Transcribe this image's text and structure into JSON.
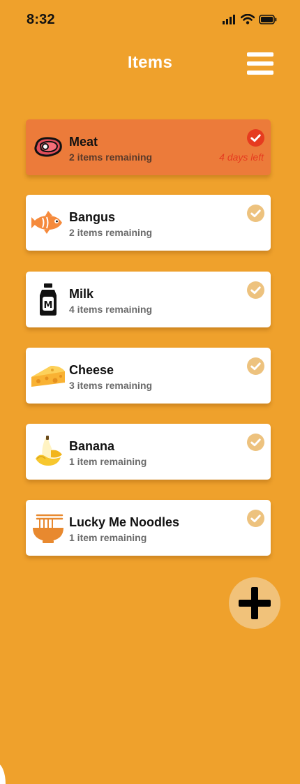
{
  "status_bar": {
    "time": "8:32",
    "icons": [
      "signal-icon",
      "wifi-icon",
      "battery-icon"
    ]
  },
  "header": {
    "title": "Items",
    "menu_icon": "hamburger-menu-icon"
  },
  "items": [
    {
      "name": "Meat",
      "remaining": "2 items remaining",
      "icon": "meat-icon",
      "status": "4 days left",
      "selected": true
    },
    {
      "name": "Bangus",
      "remaining": "2 items remaining",
      "icon": "fish-icon",
      "selected": false
    },
    {
      "name": "Milk",
      "remaining": "4 items remaining",
      "icon": "milk-bottle-icon",
      "selected": false
    },
    {
      "name": "Cheese",
      "remaining": "3 items remaining",
      "icon": "cheese-icon",
      "selected": false
    },
    {
      "name": "Banana",
      "remaining": "1 item remaining",
      "icon": "banana-icon",
      "selected": false
    },
    {
      "name": "Lucky Me Noodles",
      "remaining": "1 item remaining",
      "icon": "noodles-icon",
      "selected": false
    }
  ],
  "fab": {
    "icon": "plus-icon"
  },
  "colors": {
    "background": "#EFA12C",
    "card": "#FFFFFF",
    "card_selected": "#EC7B3A",
    "check_selected": "#E63B1F",
    "check_default": "#EDC27E",
    "days_left": "#E63B1F",
    "fab": "#F1C27A"
  }
}
